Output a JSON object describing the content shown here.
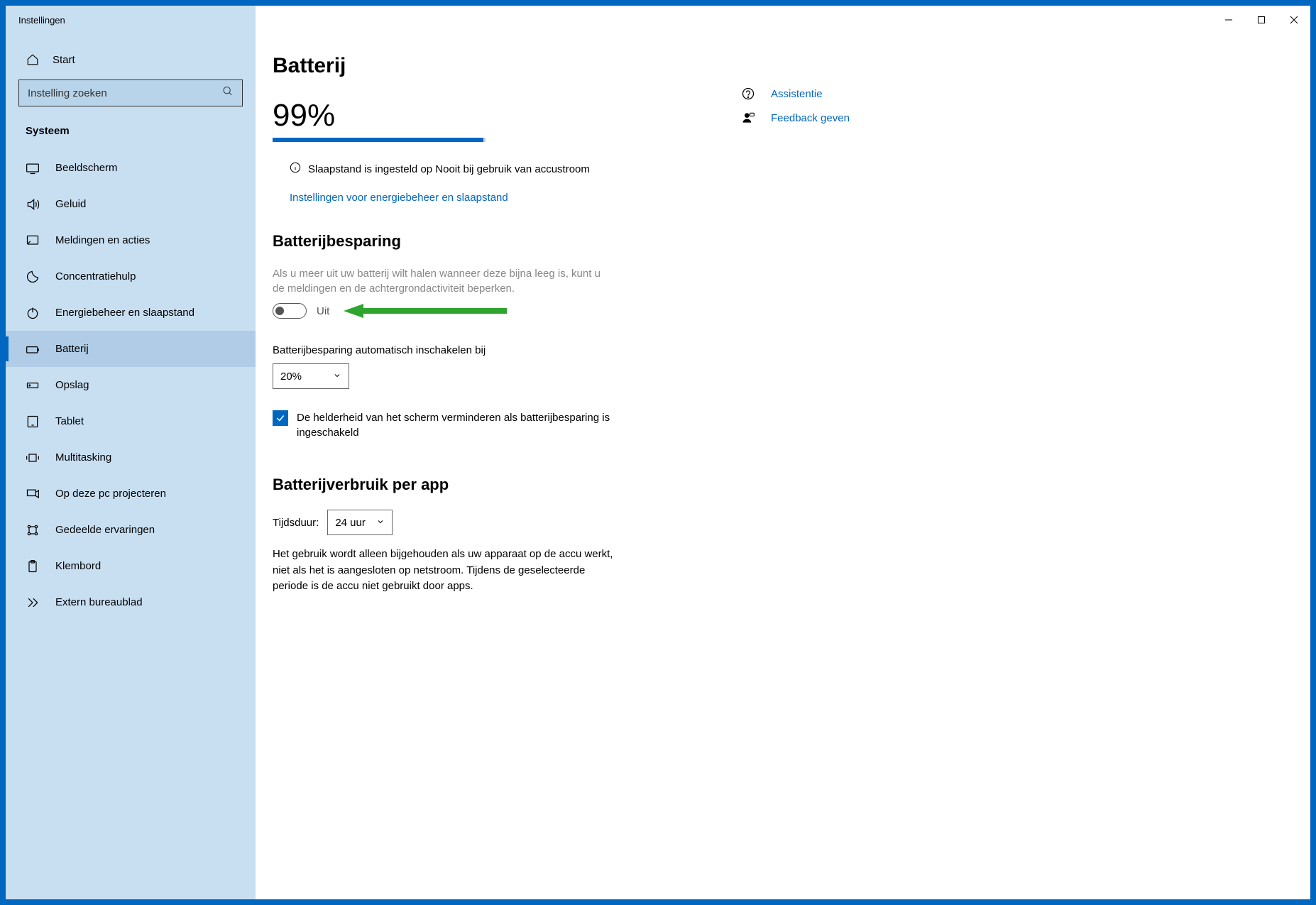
{
  "titlebar": {
    "title": "Instellingen"
  },
  "sidebar": {
    "home_label": "Start",
    "search_placeholder": "Instelling zoeken",
    "category": "Systeem",
    "items": [
      {
        "label": "Beeldscherm"
      },
      {
        "label": "Geluid"
      },
      {
        "label": "Meldingen en acties"
      },
      {
        "label": "Concentratiehulp"
      },
      {
        "label": "Energiebeheer en slaapstand"
      },
      {
        "label": "Batterij"
      },
      {
        "label": "Opslag"
      },
      {
        "label": "Tablet"
      },
      {
        "label": "Multitasking"
      },
      {
        "label": "Op deze pc projecteren"
      },
      {
        "label": "Gedeelde ervaringen"
      },
      {
        "label": "Klembord"
      },
      {
        "label": "Extern bureaublad"
      }
    ]
  },
  "main": {
    "title": "Batterij",
    "percent": "99%",
    "percent_value": 99,
    "sleep_info": "Slaapstand is ingesteld op Nooit bij gebruik van accustroom",
    "power_link": "Instellingen voor energiebeheer en slaapstand",
    "saver_title": "Batterijbesparing",
    "saver_desc": "Als u meer uit uw batterij wilt halen wanneer deze bijna leeg is, kunt u de meldingen en de achtergrondactiviteit beperken.",
    "toggle_state": "Uit",
    "auto_label": "Batterijbesparing automatisch inschakelen bij",
    "auto_value": "20%",
    "brightness_label": "De helderheid van het scherm verminderen als batterijbesparing is ingeschakeld",
    "usage_title": "Batterijverbruik per app",
    "time_label": "Tijdsduur:",
    "time_value": "24 uur",
    "usage_body": "Het gebruik wordt alleen bijgehouden als uw apparaat op de accu werkt, niet als het is aangesloten op netstroom. Tijdens de geselecteerde periode is de accu niet gebruikt door apps."
  },
  "aside": {
    "help": "Assistentie",
    "feedback": "Feedback geven"
  }
}
